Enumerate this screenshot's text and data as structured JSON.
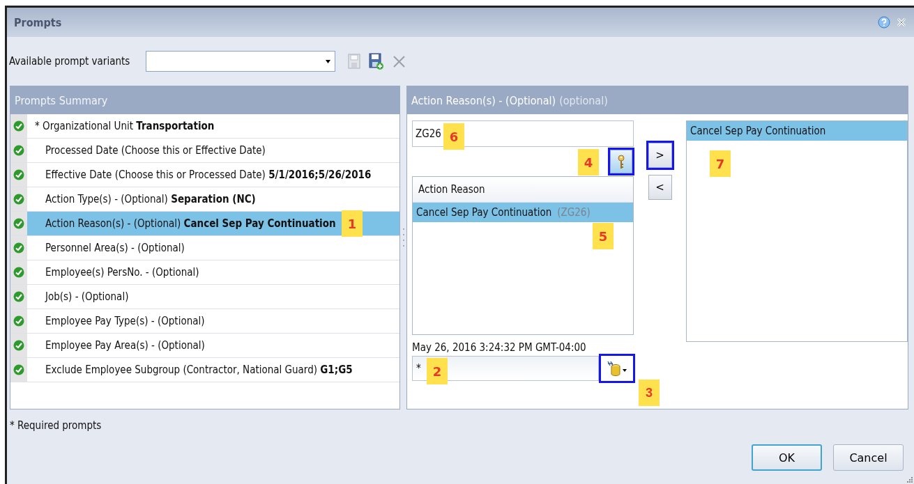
{
  "window": {
    "title": "Prompts"
  },
  "toolbar": {
    "label": "Available prompt variants"
  },
  "summary": {
    "title": "Prompts Summary",
    "rows": [
      {
        "text": "* Organizational Unit **Transportation**",
        "required": true,
        "complete": true,
        "selected": false
      },
      {
        "text": "Processed Date (Choose this or Effective Date)",
        "required": false,
        "complete": true,
        "selected": false
      },
      {
        "text": "Effective Date (Choose this or Processed Date) **5/1/2016;5/26/2016**",
        "required": false,
        "complete": true,
        "selected": false
      },
      {
        "text": "Action Type(s) - (Optional) **Separation (NC)**",
        "required": false,
        "complete": true,
        "selected": false
      },
      {
        "text": "Action Reason(s) - (Optional) **Cancel Sep Pay Continuation**",
        "required": false,
        "complete": true,
        "selected": true,
        "callout": "1"
      },
      {
        "text": "Personnel Area(s) - (Optional)",
        "required": false,
        "complete": true,
        "selected": false
      },
      {
        "text": "Employee(s) PersNo. - (Optional)",
        "required": false,
        "complete": true,
        "selected": false
      },
      {
        "text": "Job(s) - (Optional)",
        "required": false,
        "complete": true,
        "selected": false
      },
      {
        "text": "Employee Pay Type(s) - (Optional)",
        "required": false,
        "complete": true,
        "selected": false
      },
      {
        "text": "Employee Pay Area(s) - (Optional)",
        "required": false,
        "complete": true,
        "selected": false
      },
      {
        "text": "Exclude Employee Subgroup (Contractor, National Guard) **G1;G5**",
        "required": false,
        "complete": true,
        "selected": false
      }
    ]
  },
  "detail": {
    "title": "Action Reason(s) - (Optional)",
    "hint": "(optional)",
    "search_field": {
      "value": "ZG26",
      "callout": "6"
    },
    "key_button": {
      "highlighted": true,
      "callout": "4"
    },
    "list": {
      "column": "Action Reason",
      "items": [
        {
          "name": "Cancel Sep Pay Continuation",
          "code": "(ZG26)",
          "selected": true,
          "callout": "5"
        }
      ]
    },
    "timestamp": "May 26, 2016 3:24:32 PM GMT-04:00",
    "value_field": {
      "value": "*",
      "callout": "2"
    },
    "source_button": {
      "highlighted": true,
      "callout": "3"
    },
    "add_button": {
      "label": ">",
      "highlighted": true
    },
    "remove_button": {
      "label": "<",
      "highlighted": false
    },
    "selected_list": {
      "items": [
        {
          "name": "Cancel Sep Pay Continuation",
          "selected": true
        }
      ],
      "callout": "7"
    }
  },
  "footnote": "* Required prompts",
  "buttons": [
    {
      "label": "OK",
      "default": true
    },
    {
      "label": "Cancel",
      "default": false
    }
  ]
}
